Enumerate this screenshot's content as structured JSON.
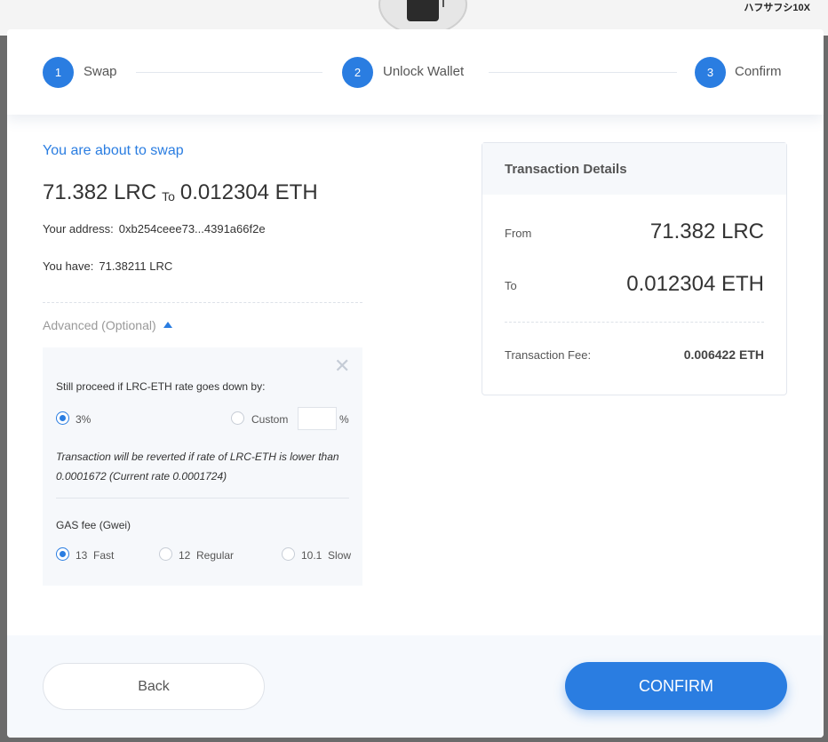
{
  "background": {
    "corner_text": "ハフサフシ10X"
  },
  "stepper": {
    "steps": [
      {
        "number": "1",
        "label": "Swap"
      },
      {
        "number": "2",
        "label": "Unlock Wallet"
      },
      {
        "number": "3",
        "label": "Confirm"
      }
    ]
  },
  "swap": {
    "title": "You are about to swap",
    "from_amount": "71.382 LRC",
    "to_word": "To",
    "to_amount": "0.012304 ETH",
    "address_label": "Your address:",
    "address_value": "0xb254ceee73...4391a66f2e",
    "have_label": "You have:",
    "have_value": "71.38211 LRC"
  },
  "advanced": {
    "label": "Advanced (Optional)",
    "close_symbol": "✕",
    "slippage_label": "Still proceed if LRC-ETH rate goes down by:",
    "option_3": "3%",
    "option_custom": "Custom",
    "custom_value": "",
    "percent_sign": "%",
    "note": "Transaction will be reverted if rate of LRC-ETH is lower than 0.0001672 (Current rate 0.0001724)",
    "gas_label": "GAS fee (Gwei)",
    "gas_options": [
      "13  Fast",
      "12  Regular",
      "10.1  Slow"
    ]
  },
  "details": {
    "title": "Transaction Details",
    "from_label": "From",
    "from_value": "71.382 LRC",
    "to_label": "To",
    "to_value": "0.012304 ETH",
    "fee_label": "Transaction Fee:",
    "fee_value": "0.006422 ETH"
  },
  "footer": {
    "back_label": "Back",
    "confirm_label": "CONFIRM"
  },
  "colors": {
    "accent": "#2a7de1",
    "panel_bg": "#f6f8fb"
  }
}
